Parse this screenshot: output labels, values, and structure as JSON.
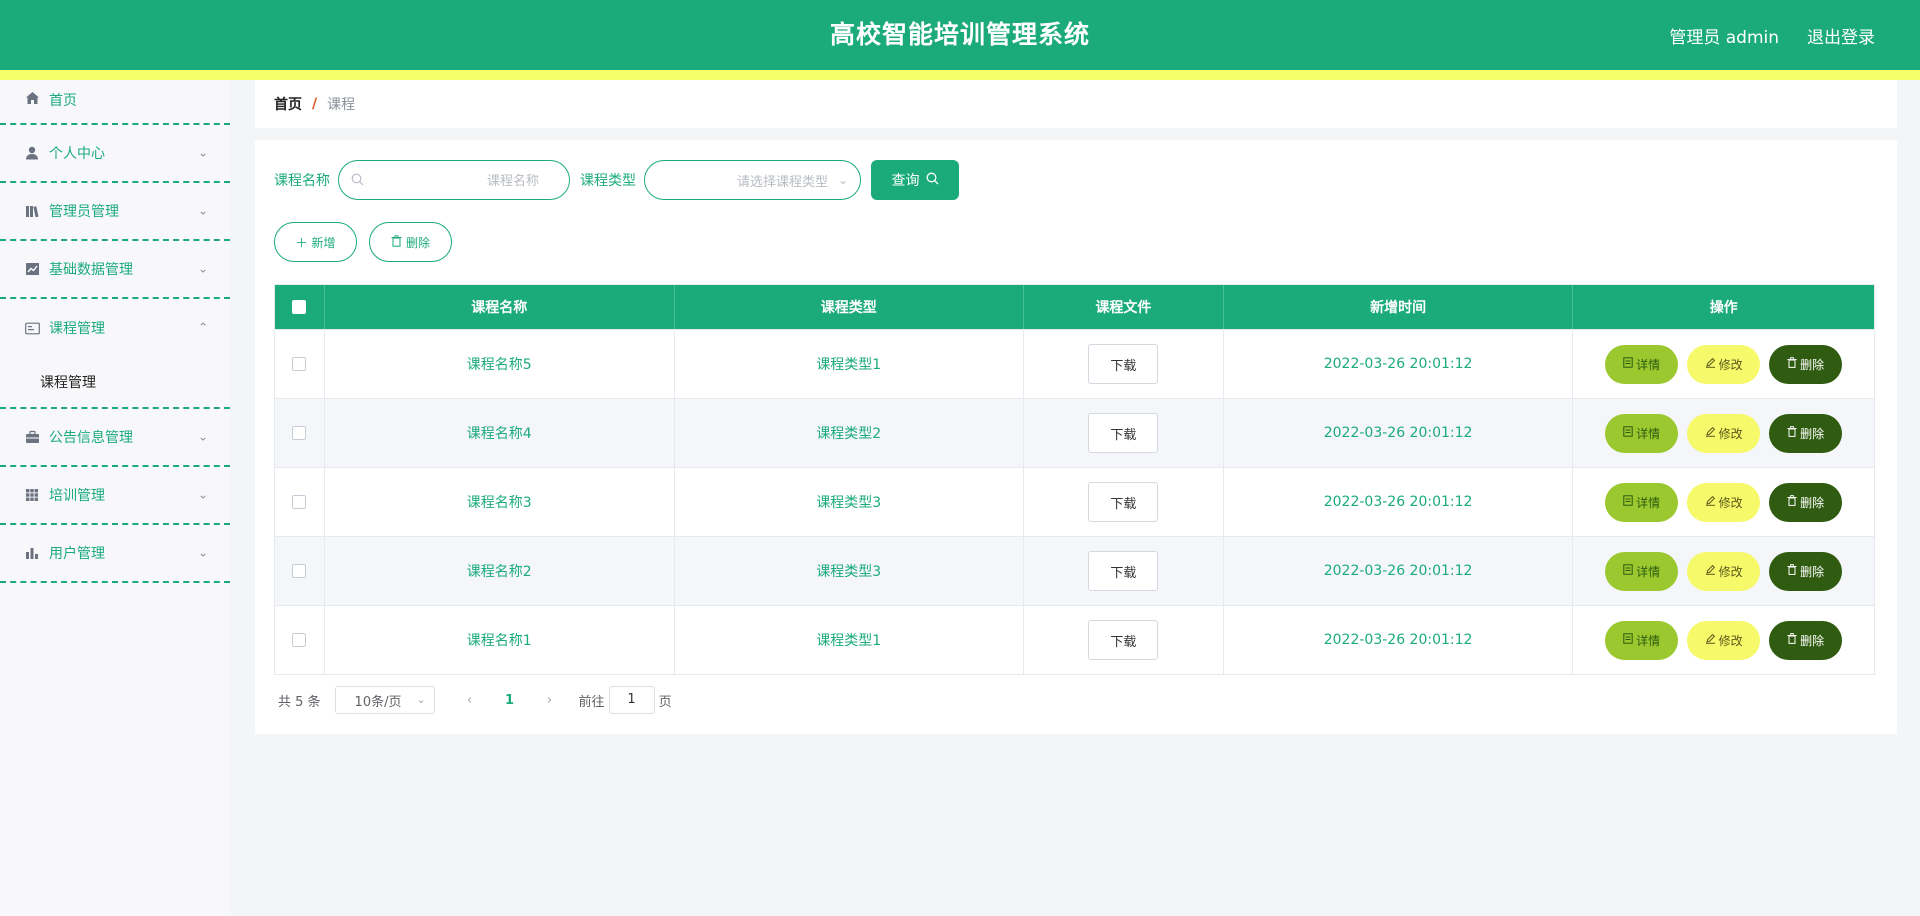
{
  "header": {
    "title": "高校智能培训管理系统",
    "user_label": "管理员 admin",
    "logout_label": "退出登录",
    "brand_color": "#1bab7b",
    "accent_color": "#f4ff6a"
  },
  "sidebar": {
    "items": [
      {
        "label": "首页",
        "icon": "home-icon"
      },
      {
        "label": "个人中心",
        "icon": "user-icon"
      },
      {
        "label": "管理员管理",
        "icon": "library-icon"
      },
      {
        "label": "基础数据管理",
        "icon": "chart-icon"
      },
      {
        "label": "课程管理",
        "icon": "id-card-icon",
        "expanded": true,
        "children": [
          {
            "label": "课程管理"
          }
        ]
      },
      {
        "label": "公告信息管理",
        "icon": "briefcase-icon"
      },
      {
        "label": "培训管理",
        "icon": "grid-icon"
      },
      {
        "label": "用户管理",
        "icon": "bar-chart-icon"
      }
    ]
  },
  "breadcrumb": {
    "home": "首页",
    "separator": "/",
    "current": "课程"
  },
  "search": {
    "name_label": "课程名称",
    "name_placeholder": "课程名称",
    "name_value": "",
    "type_label": "课程类型",
    "type_placeholder": "请选择课程类型",
    "query_label": "查询"
  },
  "actions": {
    "add_label": "新增",
    "delete_label": "删除"
  },
  "table": {
    "columns": [
      "课程名称",
      "课程类型",
      "课程文件",
      "新增时间",
      "操作"
    ],
    "rows": [
      {
        "name": "课程名称5",
        "type": "课程类型1",
        "file_button": "下载",
        "time": "2022-03-26 20:01:12"
      },
      {
        "name": "课程名称4",
        "type": "课程类型2",
        "file_button": "下载",
        "time": "2022-03-26 20:01:12"
      },
      {
        "name": "课程名称3",
        "type": "课程类型3",
        "file_button": "下载",
        "time": "2022-03-26 20:01:12"
      },
      {
        "name": "课程名称2",
        "type": "课程类型3",
        "file_button": "下载",
        "time": "2022-03-26 20:01:12"
      },
      {
        "name": "课程名称1",
        "type": "课程类型1",
        "file_button": "下载",
        "time": "2022-03-26 20:01:12"
      }
    ],
    "row_actions": {
      "detail": "详情",
      "edit": "修改",
      "delete": "删除"
    }
  },
  "pagination": {
    "total_text": "共 5 条",
    "page_size": "10条/页",
    "current_page": "1",
    "goto_prefix": "前往",
    "goto_value": "1",
    "goto_suffix": "页"
  }
}
